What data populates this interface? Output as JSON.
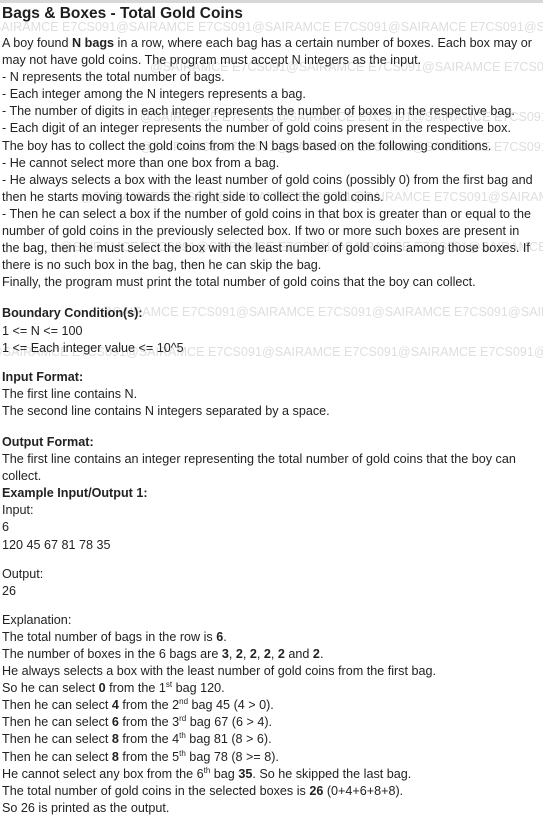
{
  "title": "Bags & Boxes - Total Gold Coins",
  "watermark": "@SAIRAMCE E7CS091@SAIRAMCE E7CS091@SAIRAMCE E7CS091@SAIRAMCE E7CS091@SAIRAMCE E7CS091",
  "intro": {
    "p1_a": "A boy found ",
    "p1_b": "N bags",
    "p1_c": " in a row, where each bag has a certain number of boxes. Each box may or may not have gold coins. The program must accept N integers as the input.",
    "bullets": [
      "- N represents the total number of bags.",
      "- Each integer among the N integers represents a bag.",
      "- The number of digits in each integer represents the number of boxes in the respective bag.",
      "- Each digit of an integer represents the number of gold coins present in the respective box."
    ],
    "p2": "The boy has to collect the gold coins from the N bags based on the following conditions.",
    "conditions": [
      "- He cannot select more than one box from a bag.",
      "- He always selects a box with the least number of gold coins (possibly 0) from the first bag and then he starts moving towards the right side to collect the gold coins.",
      "- Then he can select a box if the number of gold coins in that box is greater than or equal to the number of gold coins in the previously selected box. If two or more such boxes are present in the bag, then he must select the box with the least number of gold coins among those boxes. If there is no such box in the bag, then he can skip the bag."
    ],
    "final": "Finally, the program must print the total number of gold coins that the boy can collect."
  },
  "boundary": {
    "heading": "Boundary Condition(s):",
    "lines": [
      "1 <= N <= 100",
      "1 <= Each integer value <= 10^5"
    ]
  },
  "input_format": {
    "heading": "Input Format:",
    "lines": [
      "The first line contains N.",
      "The second line contains N integers separated by a space."
    ]
  },
  "output_format": {
    "heading": "Output Format:",
    "text": "The first line contains an integer representing the total number of gold coins that the boy can collect."
  },
  "example": {
    "heading": "Example Input/Output 1:",
    "input_label": "Input:",
    "input_lines": [
      "6",
      "120 45 67 81 78 35"
    ],
    "output_label": "Output:",
    "output_lines": [
      "26"
    ],
    "explanation_label": "Explanation:",
    "e1_a": "The total number of bags in the row is ",
    "e1_b": "6",
    "e1_c": ".",
    "e2_a": "The number of boxes in the 6 bags are ",
    "e2_b": "3",
    "e2_c": ", ",
    "e2_d": "2",
    "e2_e": ", ",
    "e2_f": "2",
    "e2_g": ", ",
    "e2_h": "2",
    "e2_i": ", ",
    "e2_j": "2",
    "e2_k": " and ",
    "e2_l": "2",
    "e2_m": ".",
    "e3": "He always selects a box with the least number of gold coins from the first bag.",
    "e4_a": "So he can select ",
    "e4_b": "0",
    "e4_c": " from the 1",
    "e4_sup": "st",
    "e4_d": " bag 120.",
    "steps": [
      {
        "a": "Then he can select ",
        "b": "4",
        "c": " from the 2",
        "sup": "nd",
        "d": " bag 45 (4 > 0)."
      },
      {
        "a": "Then he can select ",
        "b": "6",
        "c": " from the 3",
        "sup": "rd",
        "d": " bag 67 (6 > 4)."
      },
      {
        "a": "Then he can select ",
        "b": "8",
        "c": " from the 4",
        "sup": "th",
        "d": " bag 81 (8 > 6)."
      },
      {
        "a": "Then he can select ",
        "b": "8",
        "c": " from the 5",
        "sup": "th",
        "d": " bag 78 (8 >= 8)."
      }
    ],
    "e9_a": "He cannot select any box from the 6",
    "e9_sup": "th",
    "e9_b": " bag ",
    "e9_c": "35",
    "e9_d": ". So he skipped the last bag.",
    "e10_a": "The total number of gold coins in the selected boxes is ",
    "e10_b": "26",
    "e10_c": " (0+4+6+8+8).",
    "e11": "So 26 is printed as the output."
  }
}
